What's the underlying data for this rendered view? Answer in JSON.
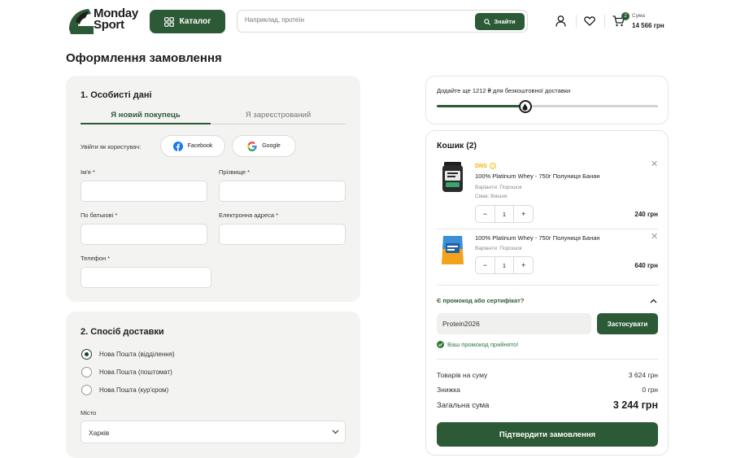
{
  "header": {
    "logo_line1": "Monday",
    "logo_line2": "Sport",
    "catalog_label": "Каталог",
    "search_placeholder": "Наприклад, протеїн",
    "search_button": "Знайти",
    "cart_count": "2",
    "sum_label": "Сума",
    "sum_value": "14 566 грн"
  },
  "page_title": "Оформлення замовлення",
  "personal": {
    "title": "1. Особисті дані",
    "tab_new": "Я новий покупець",
    "tab_registered": "Я зареєстрований",
    "login_as": "Увійти як користувач:",
    "facebook": "Facebook",
    "google": "Google",
    "first_name_label": "Ім'я *",
    "last_name_label": "Прізвище *",
    "patronymic_label": "По батькові *",
    "email_label": "Електронна адреса *",
    "phone_label": "Телефон *"
  },
  "delivery": {
    "title": "2. Спосіб доставки",
    "options": [
      "Нова Пошта (відділення)",
      "Нова Пошта (поштомат)",
      "Нова Пошта (кур'єром)"
    ],
    "selected_index": 0,
    "city_label": "Місто",
    "city_value": "Харків"
  },
  "shipping": {
    "text": "Додайте ще 1212 ₴ для безкоштовної доставки",
    "progress": 0.4
  },
  "cart": {
    "title": "Кошик (2)",
    "items": [
      {
        "brand": "DNS",
        "name": "100% Platinum Whey - 750г Полуниця Банан",
        "variant": "Варіанти: Порошок",
        "taste": "Смак: Вишня",
        "qty": "1",
        "price": "240 грн"
      },
      {
        "name": "100% Platinum Whey - 750г Полуниця Банан",
        "variant": "Варіанти: Порошок",
        "qty": "1",
        "price": "640 грн"
      }
    ],
    "promo_question": "Є промокод або сертифікат?",
    "promo_value": "Protein2026",
    "apply_label": "Застосувати",
    "promo_ok": "Ваш промокод прийнято!",
    "goods_label": "Товарів на суму",
    "goods_value": "3 624 грн",
    "discount_label": "Знижка",
    "discount_value": "0 грн",
    "total_label": "Загальна сума",
    "total_value": "3 244 грн",
    "confirm_label": "Підтвердити замовлення"
  },
  "colors": {
    "primary": "#2c5a36",
    "brand_badge": "#f2b400",
    "ok": "#2c7a3a"
  }
}
